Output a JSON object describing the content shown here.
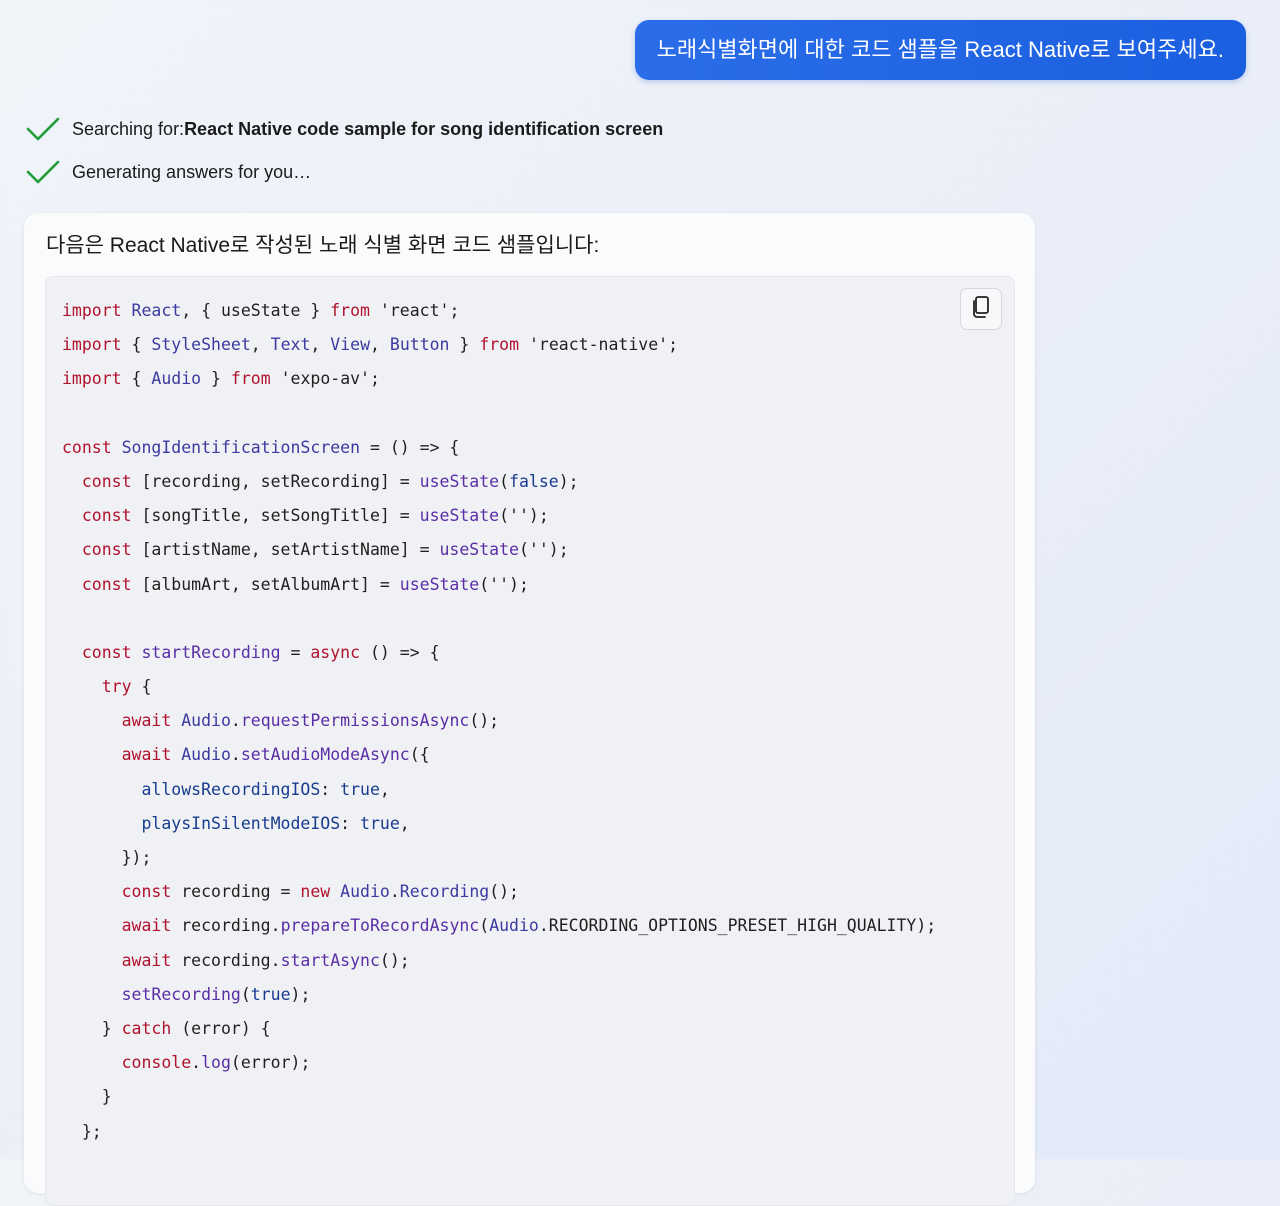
{
  "user_message": "노래식별화면에 대한 코드 샘플을 React Native로 보여주세요.",
  "progress": [
    {
      "prefix": "Searching for: ",
      "bold": "React Native code sample for song identification screen",
      "icon": "check-icon"
    },
    {
      "prefix": "Generating answers for you…",
      "bold": "",
      "icon": "check-icon"
    }
  ],
  "answer": {
    "intro": "다음은 React Native로 작성된 노래 식별 화면 코드 샘플입니다:",
    "copy_icon": "copy-icon",
    "code_lines": [
      [
        [
          "kw",
          "import"
        ],
        [
          "p",
          " "
        ],
        [
          "id",
          "React"
        ],
        [
          "p",
          ", { useState } "
        ],
        [
          "kw",
          "from"
        ],
        [
          "p",
          " 'react';"
        ]
      ],
      [
        [
          "kw",
          "import"
        ],
        [
          "p",
          " { "
        ],
        [
          "id",
          "StyleSheet"
        ],
        [
          "p",
          ", "
        ],
        [
          "id",
          "Text"
        ],
        [
          "p",
          ", "
        ],
        [
          "id",
          "View"
        ],
        [
          "p",
          ", "
        ],
        [
          "id",
          "Button"
        ],
        [
          "p",
          " } "
        ],
        [
          "kw",
          "from"
        ],
        [
          "p",
          " 'react-native';"
        ]
      ],
      [
        [
          "kw",
          "import"
        ],
        [
          "p",
          " { "
        ],
        [
          "id",
          "Audio"
        ],
        [
          "p",
          " } "
        ],
        [
          "kw",
          "from"
        ],
        [
          "p",
          " 'expo-av';"
        ]
      ],
      [
        [
          "p",
          ""
        ]
      ],
      [
        [
          "kw",
          "const"
        ],
        [
          "p",
          " "
        ],
        [
          "id",
          "SongIdentificationScreen"
        ],
        [
          "p",
          " = () => {"
        ]
      ],
      [
        [
          "p",
          "  "
        ],
        [
          "kw",
          "const"
        ],
        [
          "p",
          " [recording, setRecording] = "
        ],
        [
          "fn",
          "useState"
        ],
        [
          "p",
          "("
        ],
        [
          "lit",
          "false"
        ],
        [
          "p",
          ");"
        ]
      ],
      [
        [
          "p",
          "  "
        ],
        [
          "kw",
          "const"
        ],
        [
          "p",
          " [songTitle, setSongTitle] = "
        ],
        [
          "fn",
          "useState"
        ],
        [
          "p",
          "('');"
        ]
      ],
      [
        [
          "p",
          "  "
        ],
        [
          "kw",
          "const"
        ],
        [
          "p",
          " [artistName, setArtistName] = "
        ],
        [
          "fn",
          "useState"
        ],
        [
          "p",
          "('');"
        ]
      ],
      [
        [
          "p",
          "  "
        ],
        [
          "kw",
          "const"
        ],
        [
          "p",
          " [albumArt, setAlbumArt] = "
        ],
        [
          "fn",
          "useState"
        ],
        [
          "p",
          "('');"
        ]
      ],
      [
        [
          "p",
          ""
        ]
      ],
      [
        [
          "p",
          "  "
        ],
        [
          "kw",
          "const"
        ],
        [
          "p",
          " "
        ],
        [
          "fn",
          "startRecording"
        ],
        [
          "p",
          " = "
        ],
        [
          "kw",
          "async"
        ],
        [
          "p",
          " () => {"
        ]
      ],
      [
        [
          "p",
          "    "
        ],
        [
          "kw",
          "try"
        ],
        [
          "p",
          " {"
        ]
      ],
      [
        [
          "p",
          "      "
        ],
        [
          "kw",
          "await"
        ],
        [
          "p",
          " "
        ],
        [
          "id",
          "Audio"
        ],
        [
          "p",
          "."
        ],
        [
          "fn",
          "requestPermissionsAsync"
        ],
        [
          "p",
          "();"
        ]
      ],
      [
        [
          "p",
          "      "
        ],
        [
          "kw",
          "await"
        ],
        [
          "p",
          " "
        ],
        [
          "id",
          "Audio"
        ],
        [
          "p",
          "."
        ],
        [
          "fn",
          "setAudioModeAsync"
        ],
        [
          "p",
          "({"
        ]
      ],
      [
        [
          "p",
          "        "
        ],
        [
          "prop",
          "allowsRecordingIOS"
        ],
        [
          "p",
          ": "
        ],
        [
          "lit",
          "true"
        ],
        [
          "p",
          ","
        ]
      ],
      [
        [
          "p",
          "        "
        ],
        [
          "prop",
          "playsInSilentModeIOS"
        ],
        [
          "p",
          ": "
        ],
        [
          "lit",
          "true"
        ],
        [
          "p",
          ","
        ]
      ],
      [
        [
          "p",
          "      });"
        ]
      ],
      [
        [
          "p",
          "      "
        ],
        [
          "kw",
          "const"
        ],
        [
          "p",
          " recording = "
        ],
        [
          "kw",
          "new"
        ],
        [
          "p",
          " "
        ],
        [
          "id",
          "Audio"
        ],
        [
          "p",
          "."
        ],
        [
          "id",
          "Recording"
        ],
        [
          "p",
          "();"
        ]
      ],
      [
        [
          "p",
          "      "
        ],
        [
          "kw",
          "await"
        ],
        [
          "p",
          " recording."
        ],
        [
          "fn",
          "prepareToRecordAsync"
        ],
        [
          "p",
          "("
        ],
        [
          "id",
          "Audio"
        ],
        [
          "p",
          ".RECORDING_OPTIONS_PRESET_HIGH_QUALITY);"
        ]
      ],
      [
        [
          "p",
          "      "
        ],
        [
          "kw",
          "await"
        ],
        [
          "p",
          " recording."
        ],
        [
          "fn",
          "startAsync"
        ],
        [
          "p",
          "();"
        ]
      ],
      [
        [
          "p",
          "      "
        ],
        [
          "fn",
          "setRecording"
        ],
        [
          "p",
          "("
        ],
        [
          "lit",
          "true"
        ],
        [
          "p",
          ");"
        ]
      ],
      [
        [
          "p",
          "    } "
        ],
        [
          "kw",
          "catch"
        ],
        [
          "p",
          " (error) {"
        ]
      ],
      [
        [
          "p",
          "      "
        ],
        [
          "kw",
          "console"
        ],
        [
          "p",
          "."
        ],
        [
          "fn",
          "log"
        ],
        [
          "p",
          "(error);"
        ]
      ],
      [
        [
          "p",
          "    }"
        ]
      ],
      [
        [
          "p",
          "  };"
        ]
      ]
    ]
  },
  "colors": {
    "user_bubble": "#1a5fe0",
    "check": "#1f9d3a",
    "keyword": "#b1122e",
    "function": "#5a2ea6",
    "identifier": "#3a3aa0",
    "literal": "#173b8f"
  }
}
